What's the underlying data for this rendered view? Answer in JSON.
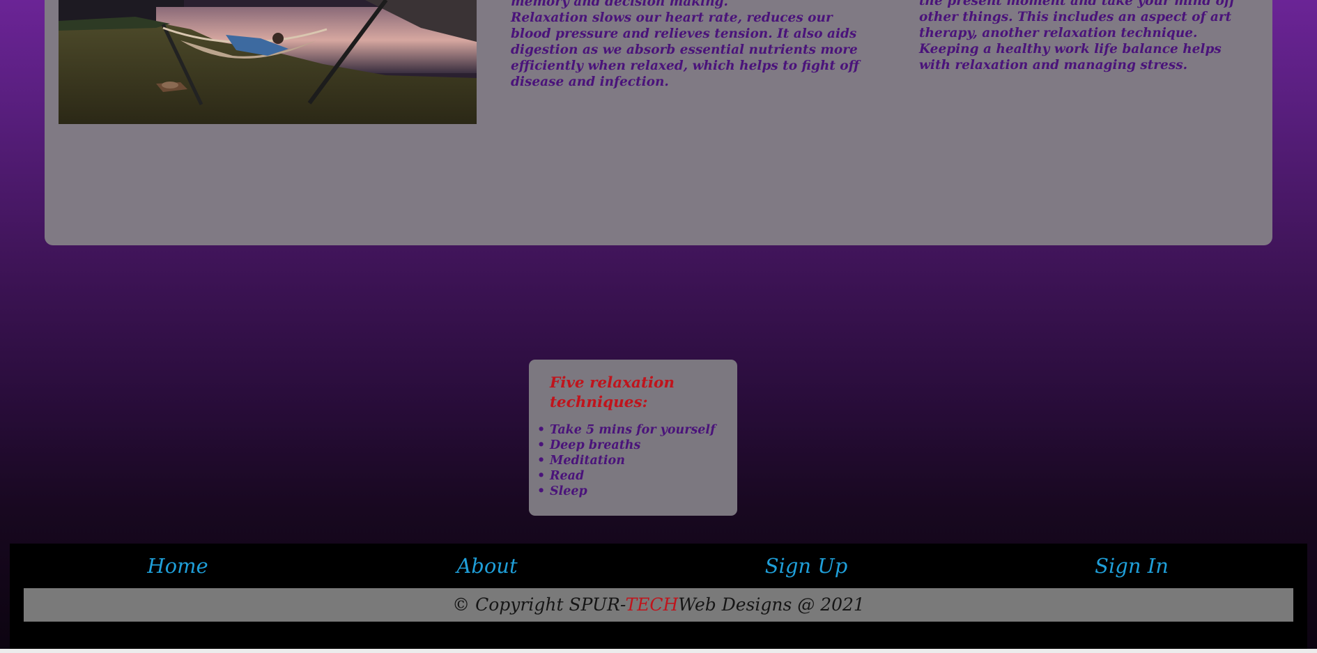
{
  "main": {
    "col1_paragraphs": [
      "memory and decision making.",
      "Relaxation slows our heart rate, reduces our blood pressure and relieves tension. It also aids digestion as we absorb essential nutrients more efficiently when relaxed, which helps to fight off disease and infection."
    ],
    "col2_paragraphs": [
      "the present moment and take your mind off other things. This includes an aspect of art therapy, another relaxation technique.",
      "Keeping a healthy work life balance helps with relaxation and managing stress."
    ]
  },
  "techniques": {
    "title": "Five relaxation techniques:",
    "items": [
      "Take 5 mins for yourself",
      "Deep breaths",
      "Meditation",
      "Read",
      "Sleep"
    ]
  },
  "footer": {
    "nav": [
      {
        "label": "Home"
      },
      {
        "label": "About"
      },
      {
        "label": "Sign Up"
      },
      {
        "label": "Sign In"
      }
    ],
    "copyright_prefix": "© Copyright SPUR-",
    "copyright_accent": "TECH",
    "copyright_suffix": "Web Designs @ 2021"
  },
  "colors": {
    "body_text": "#4a137a",
    "heading_accent": "#c0141c",
    "nav_link": "#1f9fd9",
    "card_bg": "#807a84",
    "footer_bg": "#000000"
  },
  "icons": {
    "list_bullet": "•"
  }
}
